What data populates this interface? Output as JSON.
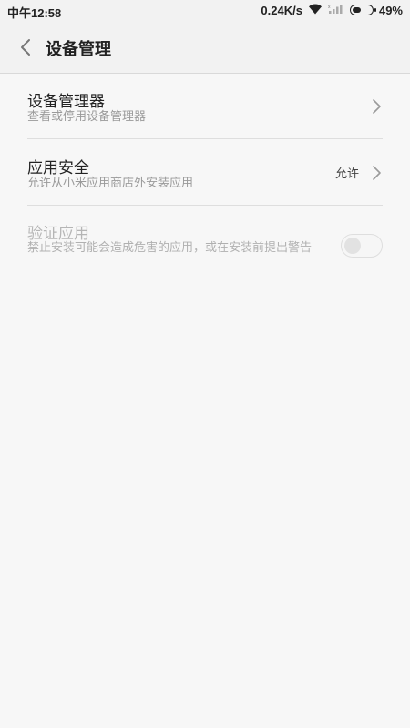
{
  "status_bar": {
    "time": "中午12:58",
    "network_speed": "0.24K/s",
    "battery_percent": "49%",
    "battery_level": 0.49,
    "icons": [
      "wifi-icon",
      "signal-icon",
      "battery-icon"
    ]
  },
  "header": {
    "back_icon": "chevron-left-icon",
    "title": "设备管理"
  },
  "settings": [
    {
      "title": "设备管理器",
      "subtitle": "查看或停用设备管理器",
      "accessory": "chevron-right-icon"
    },
    {
      "title": "应用安全",
      "subtitle": "允许从小米应用商店外安装应用",
      "value": "允许",
      "accessory": "chevron-right-icon"
    },
    {
      "title": "验证应用",
      "subtitle": "禁止安装可能会造成危害的应用，或在安装前提出警告",
      "toggle_on": false,
      "disabled": true
    }
  ],
  "colors": {
    "background": "#f7f7f7",
    "header_bg": "#f2f2f2",
    "divider": "#dedede",
    "primary_text": "#222222",
    "secondary_text": "#9a9a9a",
    "disabled_text": "#b5b5b5"
  }
}
